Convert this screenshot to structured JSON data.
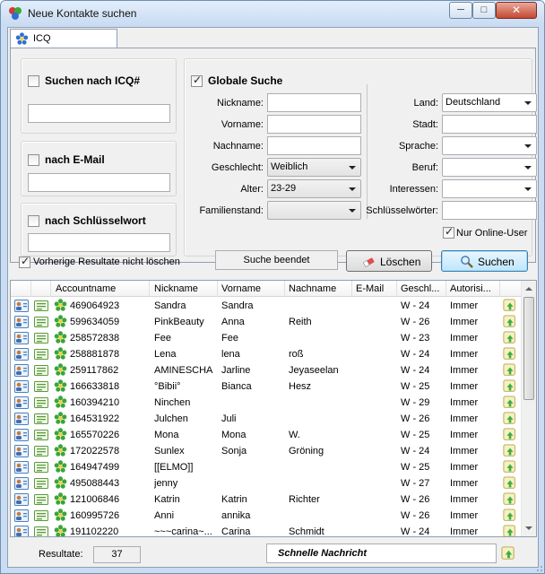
{
  "window": {
    "title": "Neue Kontakte suchen",
    "minimize": "─",
    "maximize": "□",
    "close": "✕"
  },
  "tab": {
    "label": "ICQ"
  },
  "search_icq": {
    "label": "Suchen nach ICQ#",
    "value": ""
  },
  "search_email": {
    "label": "nach E-Mail",
    "value": ""
  },
  "search_keyword": {
    "label": "nach Schlüsselwort",
    "value": ""
  },
  "global": {
    "label": "Globale Suche",
    "nickname_label": "Nickname:",
    "vorname_label": "Vorname:",
    "nachname_label": "Nachname:",
    "geschlecht_label": "Geschlecht:",
    "geschlecht_value": "Weiblich",
    "alter_label": "Alter:",
    "alter_value": "23-29",
    "familienstand_label": "Familienstand:",
    "familienstand_value": "",
    "land_label": "Land:",
    "land_value": "Deutschland",
    "stadt_label": "Stadt:",
    "sprache_label": "Sprache:",
    "beruf_label": "Beruf:",
    "interessen_label": "Interessen:",
    "schluesselwoerter_label": "Schlüsselwörter:",
    "online_only_label": "Nur Online-User"
  },
  "actions": {
    "keep_results_label": "Vorherige Resultate nicht löschen",
    "status": "Suche beendet",
    "clear_label": "Löschen",
    "search_label": "Suchen"
  },
  "results": {
    "columns": [
      "Accountname",
      "Nickname",
      "Vorname",
      "Nachname",
      "E-Mail",
      "Geschl...",
      "Autorisi..."
    ],
    "rows": [
      {
        "account": "469064923",
        "nick": "Sandra",
        "vorname": "Sandra",
        "nachname": "",
        "email": "",
        "geschl": "W - 24",
        "auth": "Immer"
      },
      {
        "account": "599634059",
        "nick": "PinkBeauty",
        "vorname": "Anna",
        "nachname": "Reith",
        "email": "",
        "geschl": "W - 26",
        "auth": "Immer"
      },
      {
        "account": "258572838",
        "nick": "Fee",
        "vorname": "Fee",
        "nachname": "",
        "email": "",
        "geschl": "W - 23",
        "auth": "Immer"
      },
      {
        "account": "258881878",
        "nick": "Lena",
        "vorname": "lena",
        "nachname": "roß",
        "email": "",
        "geschl": "W - 24",
        "auth": "Immer"
      },
      {
        "account": "259117862",
        "nick": "AMINESCHA",
        "vorname": "Jarline",
        "nachname": "Jeyaseelan",
        "email": "",
        "geschl": "W - 24",
        "auth": "Immer"
      },
      {
        "account": "166633818",
        "nick": "°Bibii°",
        "vorname": "Bianca",
        "nachname": "Hesz",
        "email": "",
        "geschl": "W - 25",
        "auth": "Immer"
      },
      {
        "account": "160394210",
        "nick": "Ninchen",
        "vorname": "",
        "nachname": "",
        "email": "",
        "geschl": "W - 29",
        "auth": "Immer"
      },
      {
        "account": "164531922",
        "nick": "Julchen",
        "vorname": "Juli",
        "nachname": "",
        "email": "",
        "geschl": "W - 26",
        "auth": "Immer"
      },
      {
        "account": "165570226",
        "nick": "Mona",
        "vorname": "Mona",
        "nachname": "W.",
        "email": "",
        "geschl": "W - 25",
        "auth": "Immer"
      },
      {
        "account": "172022578",
        "nick": "Sunlex",
        "vorname": "Sonja",
        "nachname": "Gröning",
        "email": "",
        "geschl": "W - 24",
        "auth": "Immer"
      },
      {
        "account": "164947499",
        "nick": "[[ELMO]]",
        "vorname": "",
        "nachname": "",
        "email": "",
        "geschl": "W - 25",
        "auth": "Immer"
      },
      {
        "account": "495088443",
        "nick": "jenny",
        "vorname": "",
        "nachname": "",
        "email": "",
        "geschl": "W - 27",
        "auth": "Immer"
      },
      {
        "account": "121006846",
        "nick": "Katrin",
        "vorname": "Katrin",
        "nachname": "Richter",
        "email": "",
        "geschl": "W - 26",
        "auth": "Immer"
      },
      {
        "account": "160995726",
        "nick": "Anni",
        "vorname": "annika",
        "nachname": "",
        "email": "",
        "geschl": "W - 26",
        "auth": "Immer"
      },
      {
        "account": "191102220",
        "nick": "~~~carina~...",
        "vorname": "Carina",
        "nachname": "Schmidt",
        "email": "",
        "geschl": "W - 24",
        "auth": "Immer"
      }
    ]
  },
  "footer": {
    "results_label": "Resultate:",
    "results_count": "37",
    "quick_message": "Schnelle Nachricht"
  }
}
